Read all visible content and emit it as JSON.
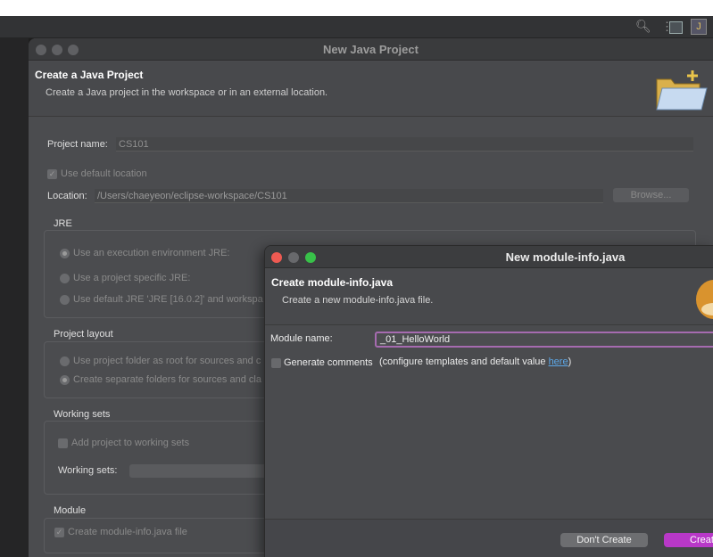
{
  "ide": {
    "toolbar_icons": [
      "search-icon",
      "open-perspective-icon",
      "java-perspective-icon"
    ]
  },
  "main_dialog": {
    "title": "New Java Project",
    "banner_title": "Create a Java Project",
    "banner_desc": "Create a Java project in the workspace or in an external location.",
    "project_name_label": "Project name:",
    "project_name_value": "CS101",
    "use_default_location_label": "Use default location",
    "location_label": "Location:",
    "location_value": "/Users/chaeyeon/eclipse-workspace/CS101",
    "browse_label": "Browse...",
    "jre": {
      "label": "JRE",
      "option1": "Use an execution environment JRE:",
      "option2": "Use a project specific JRE:",
      "option3": "Use default JRE 'JRE [16.0.2]' and workspa"
    },
    "layout": {
      "label": "Project layout",
      "option1": "Use project folder as root for sources and c",
      "option2": "Create separate folders for sources and cla"
    },
    "working_sets": {
      "label": "Working sets",
      "add_label": "Add project to working sets",
      "sets_label": "Working sets:"
    },
    "module": {
      "label": "Module",
      "create_label": "Create module-info.java file"
    }
  },
  "module_dialog": {
    "title": "New module-info.java",
    "banner_title": "Create module-info.java",
    "banner_desc": "Create a new module-info.java file.",
    "module_name_label": "Module name:",
    "module_name_value": "_01_HelloWorld",
    "generate_comments_label": "Generate comments",
    "configure_text": "(configure templates and default value ",
    "here_link": "here",
    "configure_close": ")",
    "dont_create_label": "Don't Create",
    "create_label": "Create"
  }
}
